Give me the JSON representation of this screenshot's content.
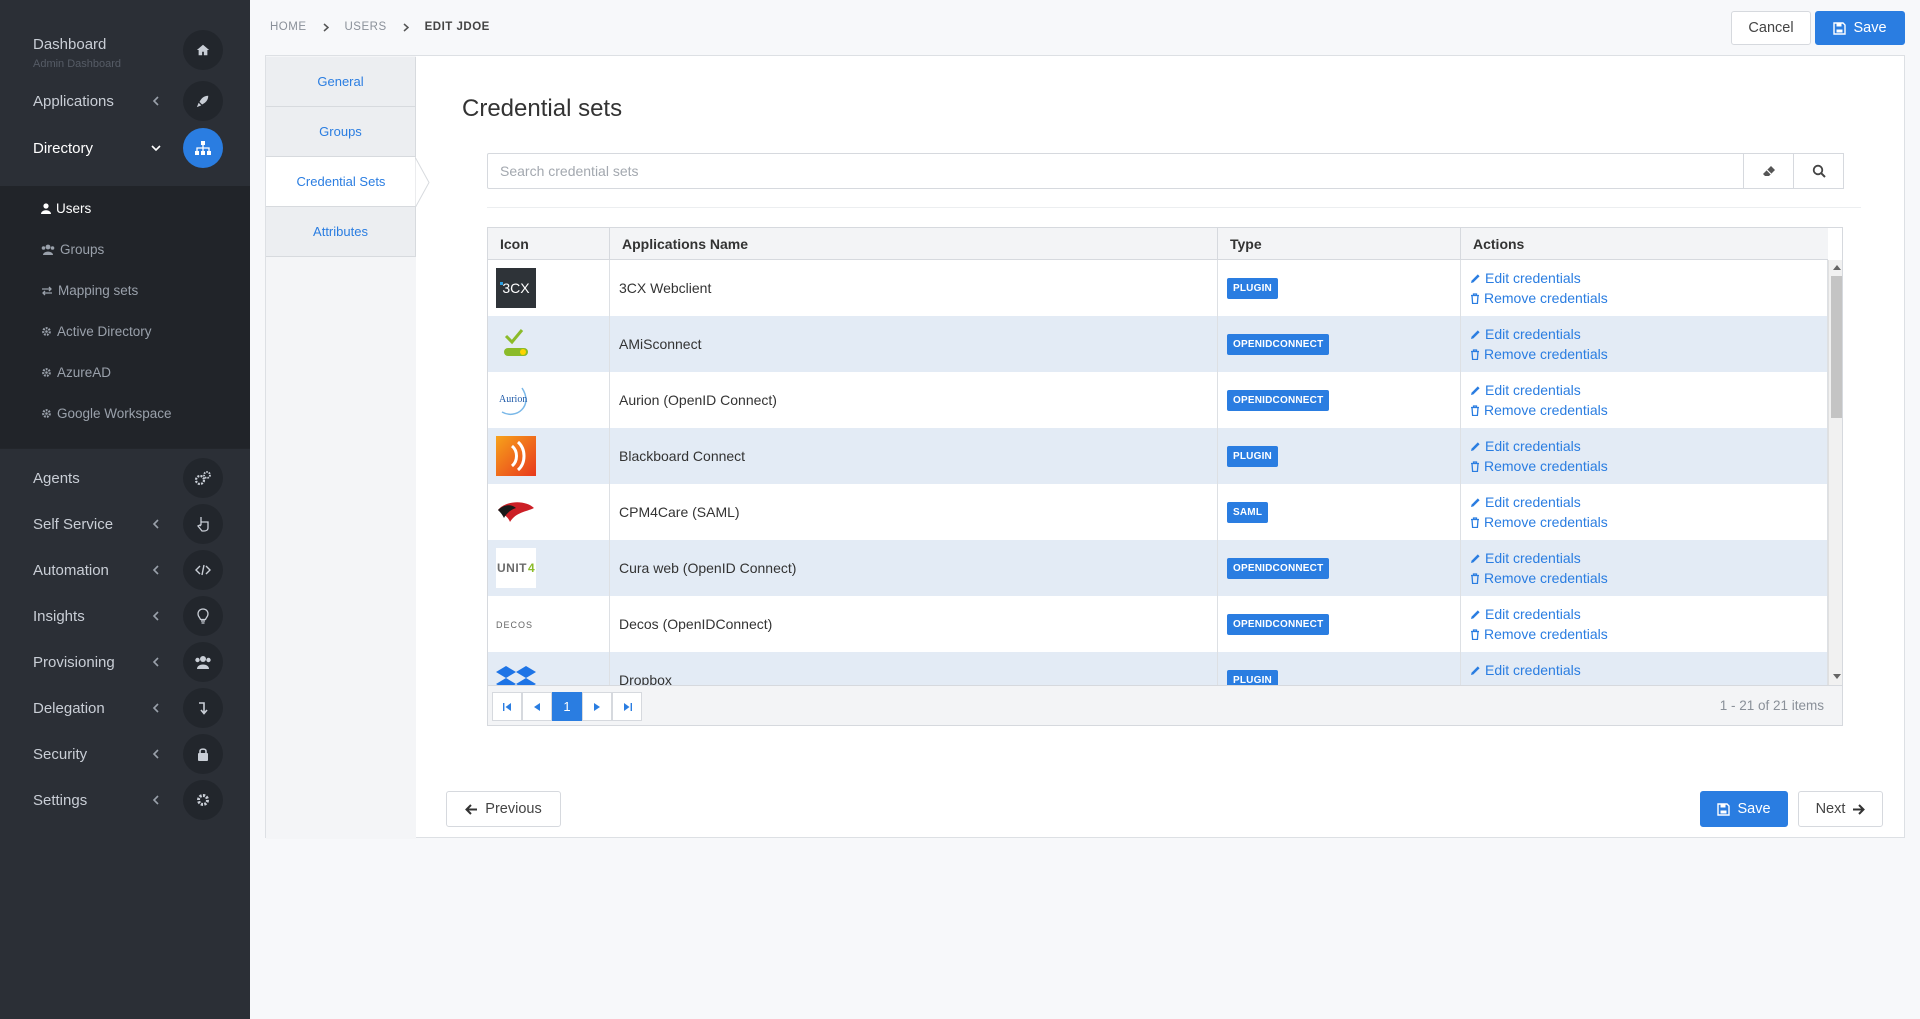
{
  "colors": {
    "accent": "#2a7de1",
    "sidebar_bg": "#2b2f36",
    "row_alt": "#e3ebf5"
  },
  "sidebar": {
    "dashboard": {
      "label": "Dashboard",
      "sublabel": "Admin Dashboard",
      "icon": "home-icon"
    },
    "items": [
      {
        "label": "Applications",
        "icon": "rocket-icon"
      },
      {
        "label": "Directory",
        "icon": "sitemap-icon",
        "active": true
      },
      {
        "label": "Agents",
        "icon": "cogs-icon"
      },
      {
        "label": "Self Service",
        "icon": "hand-pointer-icon"
      },
      {
        "label": "Automation",
        "icon": "code-icon"
      },
      {
        "label": "Insights",
        "icon": "lightbulb-icon"
      },
      {
        "label": "Provisioning",
        "icon": "users-icon"
      },
      {
        "label": "Delegation",
        "icon": "level-down-icon"
      },
      {
        "label": "Security",
        "icon": "lock-icon"
      },
      {
        "label": "Settings",
        "icon": "gear-icon"
      }
    ],
    "directory_sub": [
      {
        "label": "Users",
        "icon": "user-icon",
        "active": true
      },
      {
        "label": "Groups",
        "icon": "users-icon"
      },
      {
        "label": "Mapping sets",
        "icon": "exchange-icon"
      },
      {
        "label": "Active Directory",
        "icon": "gear-icon"
      },
      {
        "label": "AzureAD",
        "icon": "gear-icon"
      },
      {
        "label": "Google Workspace",
        "icon": "gear-icon"
      }
    ]
  },
  "breadcrumb": {
    "home": "HOME",
    "users": "USERS",
    "current": "EDIT JDOE"
  },
  "toolbar": {
    "cancel_label": "Cancel",
    "save_label": "Save"
  },
  "tabs": [
    "General",
    "Groups",
    "Credential Sets",
    "Attributes"
  ],
  "active_tab": "Credential Sets",
  "panel_title": "Credential sets",
  "search": {
    "placeholder": "Search credential sets",
    "value": ""
  },
  "table": {
    "columns": [
      "Icon",
      "Applications Name",
      "Type",
      "Actions"
    ],
    "edit_label": "Edit credentials",
    "remove_label": "Remove credentials",
    "rows": [
      {
        "name": "3CX Webclient",
        "type": "PLUGIN",
        "icon": "3cx-logo"
      },
      {
        "name": "AMiSconnect",
        "type": "OPENIDCONNECT",
        "icon": "amisconnect-logo"
      },
      {
        "name": "Aurion (OpenID Connect)",
        "type": "OPENIDCONNECT",
        "icon": "aurion-logo"
      },
      {
        "name": "Blackboard Connect",
        "type": "PLUGIN",
        "icon": "blackboard-logo"
      },
      {
        "name": "CPM4Care (SAML)",
        "type": "SAML",
        "icon": "cpm4care-logo"
      },
      {
        "name": "Cura web (OpenID Connect)",
        "type": "OPENIDCONNECT",
        "icon": "unit4-logo"
      },
      {
        "name": "Decos (OpenIDConnect)",
        "type": "OPENIDCONNECT",
        "icon": "decos-logo"
      },
      {
        "name": "Dropbox",
        "type": "PLUGIN",
        "icon": "dropbox-logo"
      }
    ]
  },
  "pager": {
    "current_page": "1",
    "info": "1 - 21 of 21 items"
  },
  "footer": {
    "previous_label": "Previous",
    "save_label": "Save",
    "next_label": "Next"
  }
}
